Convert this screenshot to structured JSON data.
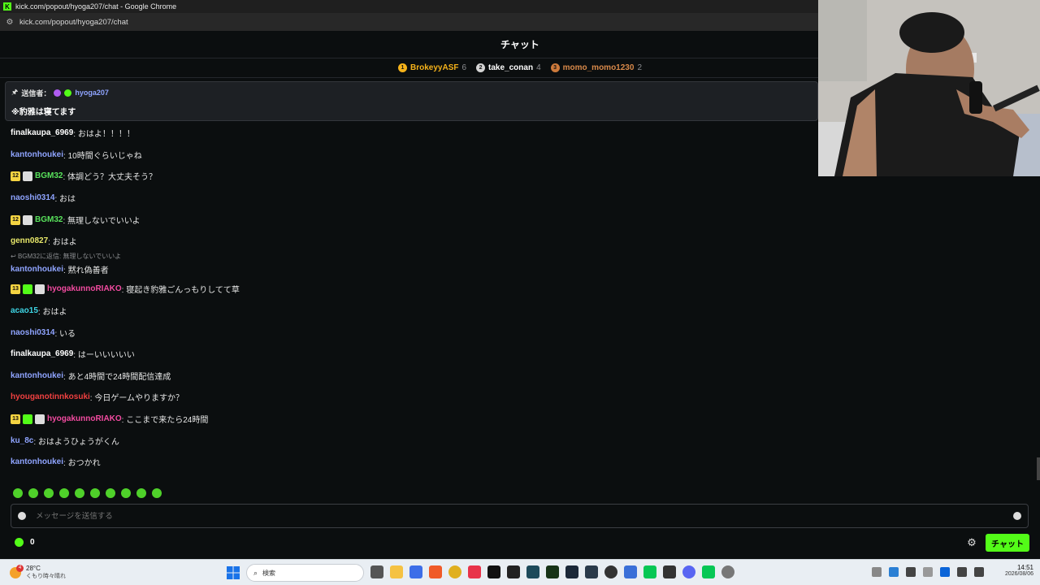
{
  "window": {
    "title": "kick.com/popout/hyoga207/chat - Google Chrome",
    "url": "kick.com/popout/hyoga207/chat"
  },
  "chat": {
    "header": "チャット",
    "leaderboard": [
      {
        "rank": "1",
        "name": "BrokeyyASF",
        "count": "6",
        "color": "#f5b21a"
      },
      {
        "rank": "2",
        "name": "take_conan",
        "count": "4",
        "color": "#ffffff"
      },
      {
        "rank": "3",
        "name": "momo_momo1230",
        "count": "2",
        "color": "#d8894a"
      }
    ],
    "pinned": {
      "label": "送信者：",
      "by": "hyoga207",
      "text": "※豹雅は寝てます"
    },
    "messages": [
      {
        "user": "finalkaupa_6969",
        "text": ": おはよ！！！！",
        "color": "#ffffff",
        "badges": []
      },
      {
        "user": "kantonhoukei",
        "text": ": 10時間ぐらいじゃね",
        "color": "#8fa4ff",
        "badges": []
      },
      {
        "user": "BGM32",
        "text": ": 体調どう？大丈夫そう？",
        "color": "#59e35c",
        "badges": [
          "12",
          "mod"
        ]
      },
      {
        "user": "naoshi0314",
        "text": ": おは",
        "color": "#8fa4ff",
        "badges": []
      },
      {
        "user": "BGM32",
        "text": ": 無理しないでいいよ",
        "color": "#59e35c",
        "badges": [
          "12",
          "mod"
        ]
      },
      {
        "user": "genn0827",
        "text": ": おはよ",
        "color": "#e8e86a",
        "badges": []
      },
      {
        "user": "kantonhoukei",
        "text": ": 黙れ偽善者",
        "color": "#8fa4ff",
        "badges": [],
        "reply": "BGM32に返信: 無理しないでいいよ"
      },
      {
        "user": "hyogakunnoRIAKO",
        "text": ": 寝起き豹雅ごんっもりしてて草",
        "color": "#f24ba0",
        "badges": [
          "13",
          "gift",
          "mod"
        ]
      },
      {
        "user": "acao15",
        "text": ": おはよ",
        "color": "#3ed6e6",
        "badges": []
      },
      {
        "user": "naoshi0314",
        "text": ": いる",
        "color": "#8fa4ff",
        "badges": []
      },
      {
        "user": "finalkaupa_6969",
        "text": ": はーいいいいい",
        "color": "#ffffff",
        "badges": []
      },
      {
        "user": "kantonhoukei",
        "text": ": あと4時間で24時間配信達成",
        "color": "#8fa4ff",
        "badges": []
      },
      {
        "user": "hyouganotinnkosuki",
        "text": ": 今日ゲームやりますか？",
        "color": "#f04040",
        "badges": []
      },
      {
        "user": "hyogakunnoRIAKO",
        "text": ": ここまで来たら24時間",
        "color": "#f24ba0",
        "badges": [
          "13",
          "gift",
          "mod"
        ]
      },
      {
        "user": "ku_8c",
        "text": ": おはようひょうがくん",
        "color": "#8fa4ff",
        "badges": []
      },
      {
        "user": "kantonhoukei",
        "text": ": おつかれ",
        "color": "#8fa4ff",
        "badges": []
      }
    ],
    "input_placeholder": "メッセージを送信する",
    "points": "0",
    "send_label": "チャット"
  },
  "taskbar": {
    "weather_temp": "28°C",
    "weather_desc": "くもり時々晴れ",
    "weather_badge": "4",
    "search": "検索",
    "time": "14:51",
    "date": "2026/08/06"
  }
}
